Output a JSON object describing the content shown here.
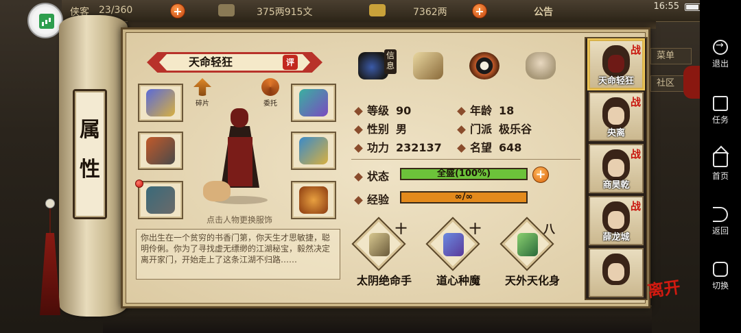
{
  "topbar": {
    "prestige": "23/360",
    "money": "375两915文",
    "gold": "7362两",
    "notice": "公告",
    "time": "16:55"
  },
  "side_tags": [
    "菜单",
    "社区"
  ],
  "scroll_label": [
    "属",
    "性"
  ],
  "character": {
    "name": "天命轻狂",
    "eval_badge": "评",
    "shard_label": "碎片",
    "delegate_label": "委托",
    "click_hint": "点击人物更换服饰",
    "bio": "你出生在一个贫穷的书香门第，你天生才思敏捷，聪明伶俐。你为了寻找虚无缥缈的江湖秘宝，毅然决定离开家门，开始走上了这条江湖不归路……"
  },
  "tabs": {
    "info_label": "信息"
  },
  "stats": [
    {
      "label": "等级",
      "value": "90"
    },
    {
      "label": "年龄",
      "value": "18"
    },
    {
      "label": "性别",
      "value": "男"
    },
    {
      "label": "门派",
      "value": "极乐谷"
    },
    {
      "label": "功力",
      "value": "232137"
    },
    {
      "label": "名望",
      "value": "648"
    }
  ],
  "status": {
    "label": "状态",
    "text": "全盛(100%)",
    "fill_fraction": 1.0,
    "color": "#6cc23a"
  },
  "experience": {
    "label": "经验",
    "text": "∞/∞",
    "fill_fraction": 1.0,
    "color": "#e38a1c"
  },
  "skills": [
    {
      "name": "太阴绝命手",
      "level": "十"
    },
    {
      "name": "道心种魔",
      "level": "十"
    },
    {
      "name": "天外天化身",
      "level": "八"
    }
  ],
  "roster": [
    {
      "name": "天命轻狂",
      "zhan": "战",
      "selected": true
    },
    {
      "name": "央离",
      "zhan": "战",
      "selected": false
    },
    {
      "name": "商昊乾",
      "zhan": "战",
      "selected": false
    },
    {
      "name": "薛龙城",
      "zhan": "战",
      "selected": false
    },
    {
      "name": "",
      "zhan": "",
      "selected": false
    }
  ],
  "leave_label": "离开",
  "navbar": [
    {
      "label": "退出",
      "icon": "exit-icon"
    },
    {
      "label": "任务",
      "icon": "task-icon"
    },
    {
      "label": "首页",
      "icon": "home-icon"
    },
    {
      "label": "返回",
      "icon": "back-icon"
    },
    {
      "label": "切换",
      "icon": "switch-icon"
    }
  ]
}
